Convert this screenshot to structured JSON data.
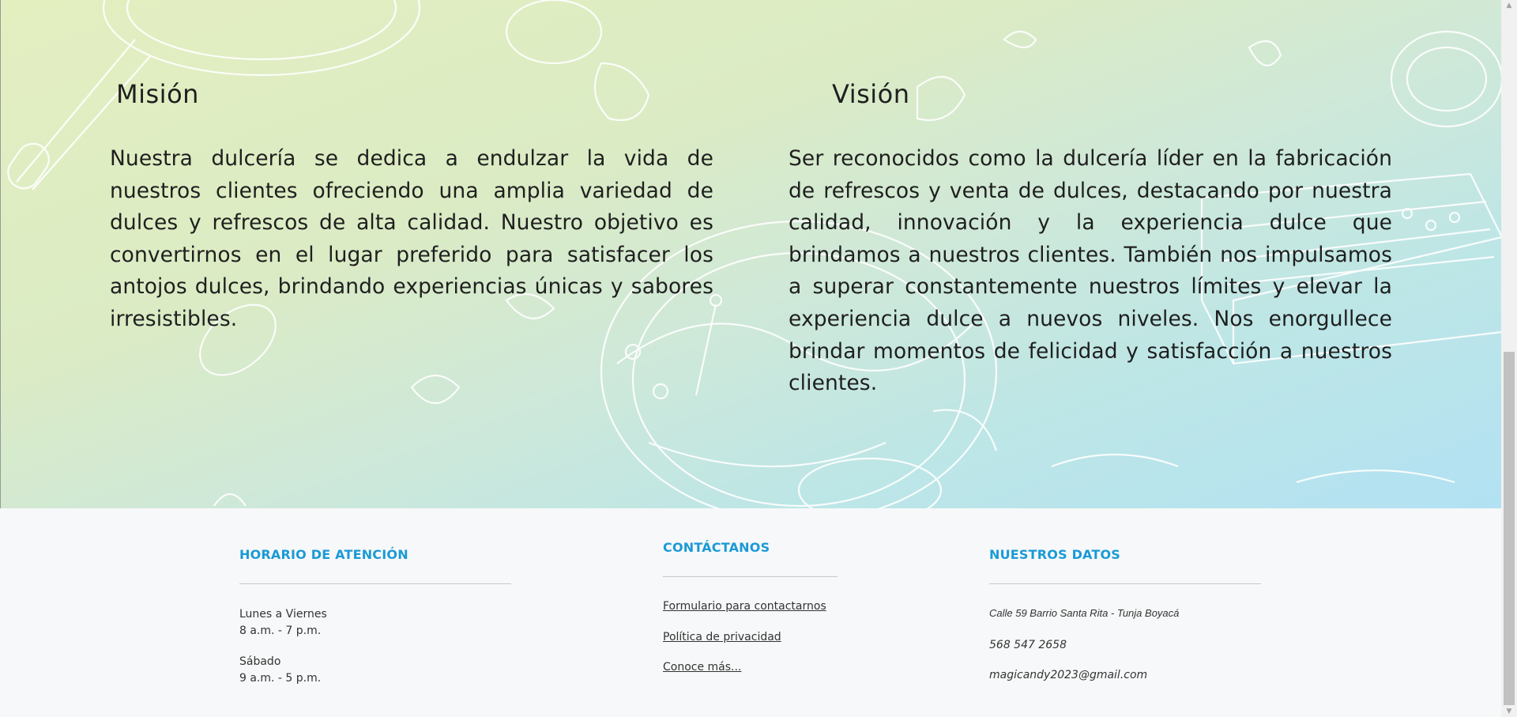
{
  "mission": {
    "title": "Misión",
    "text": "Nuestra dulcería se dedica a endulzar la vida de nuestros clientes ofreciendo una amplia variedad de dulces y refrescos de alta calidad. Nuestro objetivo es convertirnos en el lugar preferido para satisfacer los antojos dulces, brindando experiencias únicas y sabores irresistibles."
  },
  "vision": {
    "title": "Visión",
    "text": "Ser reconocidos como la dulcería líder en la fabricación de refrescos y venta de dulces, destacando por nuestra calidad, innovación y la experiencia dulce que brindamos a nuestros clientes. También nos impulsamos a superar constantemente nuestros límites y elevar la experiencia dulce a nuevos niveles. Nos enorgullece brindar momentos de felicidad y satisfacción a nuestros clientes."
  },
  "footer": {
    "hours": {
      "title": "HORARIO DE ATENCIÓN",
      "weekday_label": "Lunes a Viernes",
      "weekday_hours": "8 a.m. - 7 p.m.",
      "saturday_label": "Sábado",
      "saturday_hours": "9 a.m. - 5 p.m."
    },
    "contact": {
      "title": "CONTÁCTANOS",
      "links": [
        "Formulario para contactarnos",
        "Política de privacidad",
        "Conoce más..."
      ]
    },
    "data": {
      "title": "NUESTROS DATOS",
      "address": "Calle 59 Barrio Santa Rita - Tunja Boyacá",
      "phone": "568 547 2658",
      "email": "magicandy2023@gmail.com"
    }
  },
  "colors": {
    "accent": "#1a9ad6",
    "hero_gradient_start": "#e4efc0",
    "hero_gradient_end": "#b2e1f3",
    "footer_bg": "#f7f8f9"
  }
}
